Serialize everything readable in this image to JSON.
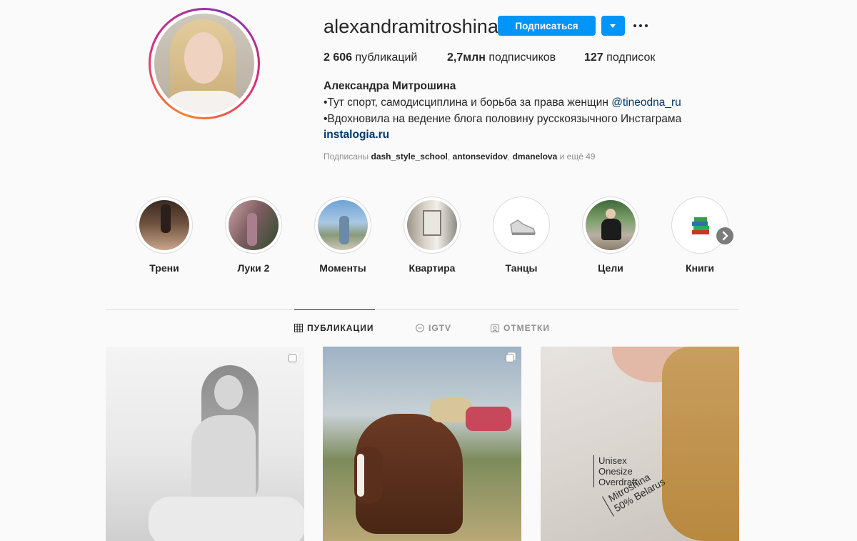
{
  "profile": {
    "username": "alexandramitroshina",
    "follow_label": "Подписаться",
    "stats": {
      "posts_count": "2 606",
      "posts_label": "публикаций",
      "followers_count": "2,7млн",
      "followers_label": "подписчиков",
      "following_count": "127",
      "following_label": "подписок"
    },
    "full_name": "Александра Митрошина",
    "bio_line1": "•Тут спорт, самодисциплина и борьба за права женщин ",
    "bio_mention": "@tineodna_ru",
    "bio_line2": "•Вдохновила на ведение блога половину русскоязычного Инстаграма",
    "website": "instalogia.ru",
    "followed_by": {
      "prefix": "Подписаны ",
      "users": [
        "dash_style_school",
        "antonsevidov",
        "dmanelova"
      ],
      "suffix": " и ещё 49"
    }
  },
  "highlights": [
    {
      "label": "Трени"
    },
    {
      "label": "Луки 2"
    },
    {
      "label": "Моменты"
    },
    {
      "label": "Квартира"
    },
    {
      "label": "Танцы"
    },
    {
      "label": "Цели"
    },
    {
      "label": "Книги"
    }
  ],
  "tabs": [
    {
      "label": "ПУБЛИКАЦИИ",
      "active": true
    },
    {
      "label": "IGTV",
      "active": false
    },
    {
      "label": "ОТМЕТКИ",
      "active": false
    }
  ],
  "posts": [
    {
      "type": "carousel"
    },
    {
      "type": "carousel"
    },
    {
      "type": "image",
      "overlay_text": [
        "Unisex",
        "Onesize",
        "Overdraft",
        "Mitroshina",
        "50% Belarus"
      ]
    }
  ],
  "colors": {
    "accent": "#0095f6",
    "link": "#00376b",
    "muted": "#8e8e8e"
  }
}
